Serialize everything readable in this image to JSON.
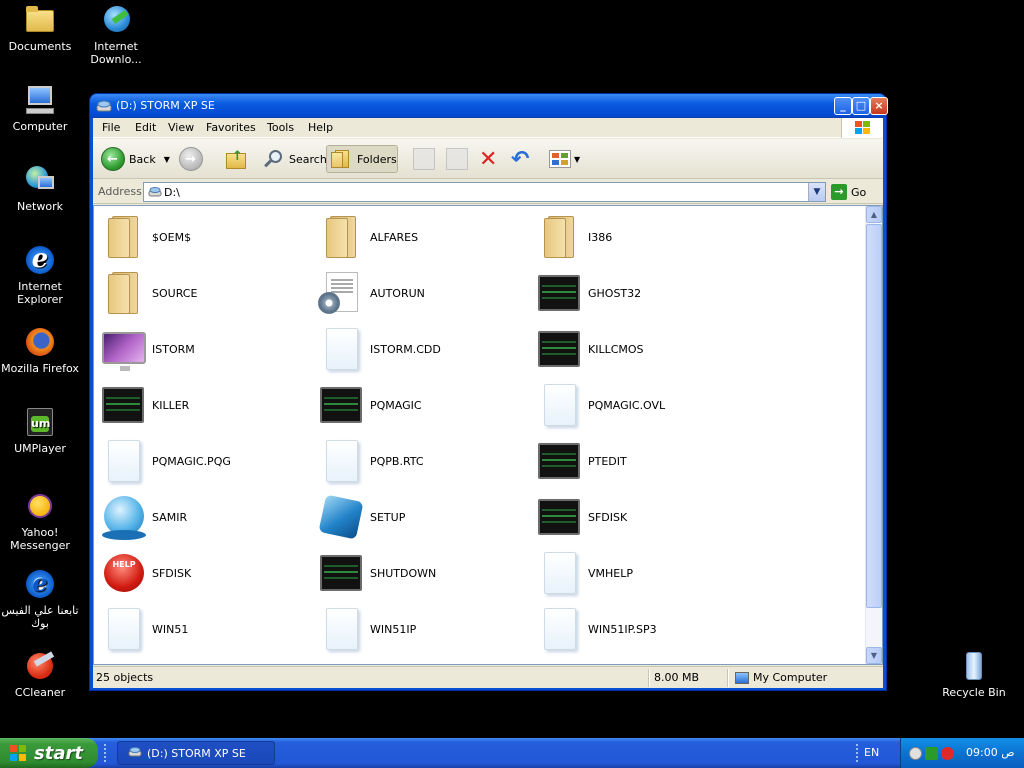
{
  "desktop": {
    "icons": [
      {
        "label": "Documents",
        "icon": "folder-icon"
      },
      {
        "label": "Internet Downlo...",
        "icon": "download-manager-icon"
      },
      {
        "label": "Computer",
        "icon": "computer-icon"
      },
      {
        "label": "Network",
        "icon": "network-icon"
      },
      {
        "label": "Internet Explorer",
        "icon": "ie-icon"
      },
      {
        "label": "Mozilla Firefox",
        "icon": "firefox-icon"
      },
      {
        "label": "UMPlayer",
        "icon": "umplayer-icon"
      },
      {
        "label": "Yahoo! Messenger",
        "icon": "yahoo-icon"
      },
      {
        "label": "تابعنا علي الفيس بوك",
        "icon": "ie-shortcut-icon"
      },
      {
        "label": "CCleaner",
        "icon": "ccleaner-icon"
      },
      {
        "label": "Recycle Bin",
        "icon": "recycle-bin-icon"
      }
    ]
  },
  "window": {
    "title": "(D:) STORM XP SE",
    "menu": [
      "File",
      "Edit",
      "View",
      "Favorites",
      "Tools",
      "Help"
    ],
    "toolbar": {
      "back": "Back",
      "search": "Search",
      "folders": "Folders"
    },
    "address": {
      "label": "Address",
      "value": "D:\\",
      "go": "Go"
    },
    "files": [
      {
        "name": "$OEM$",
        "type": "folder"
      },
      {
        "name": "ALFARES",
        "type": "folder"
      },
      {
        "name": "I386",
        "type": "folder"
      },
      {
        "name": "SOURCE",
        "type": "folder"
      },
      {
        "name": "AUTORUN",
        "type": "config"
      },
      {
        "name": "GHOST32",
        "type": "ghost"
      },
      {
        "name": "ISTORM",
        "type": "monitor"
      },
      {
        "name": "ISTORM.CDD",
        "type": "blank"
      },
      {
        "name": "KILLCMOS",
        "type": "ghost"
      },
      {
        "name": "KILLER",
        "type": "ghost"
      },
      {
        "name": "PQMAGIC",
        "type": "ghost"
      },
      {
        "name": "PQMAGIC.OVL",
        "type": "blank"
      },
      {
        "name": "PQMAGIC.PQG",
        "type": "blank"
      },
      {
        "name": "PQPB.RTC",
        "type": "blank"
      },
      {
        "name": "PTEDIT",
        "type": "ghost"
      },
      {
        "name": "SAMIR",
        "type": "globe"
      },
      {
        "name": "SETUP",
        "type": "cube"
      },
      {
        "name": "SFDISK",
        "type": "ghost"
      },
      {
        "name": "SFDISK",
        "type": "help"
      },
      {
        "name": "SHUTDOWN",
        "type": "ghost"
      },
      {
        "name": "VMHELP",
        "type": "blank"
      },
      {
        "name": "WIN51",
        "type": "blank"
      },
      {
        "name": "WIN51IP",
        "type": "blank"
      },
      {
        "name": "WIN51IP.SP3",
        "type": "blank"
      }
    ],
    "status": {
      "objects": "25 objects",
      "size": "8.00 MB",
      "location": "My Computer"
    }
  },
  "taskbar": {
    "start": "start",
    "task": "(D:) STORM XP SE",
    "lang": "EN",
    "clock": "09:00 ص"
  }
}
